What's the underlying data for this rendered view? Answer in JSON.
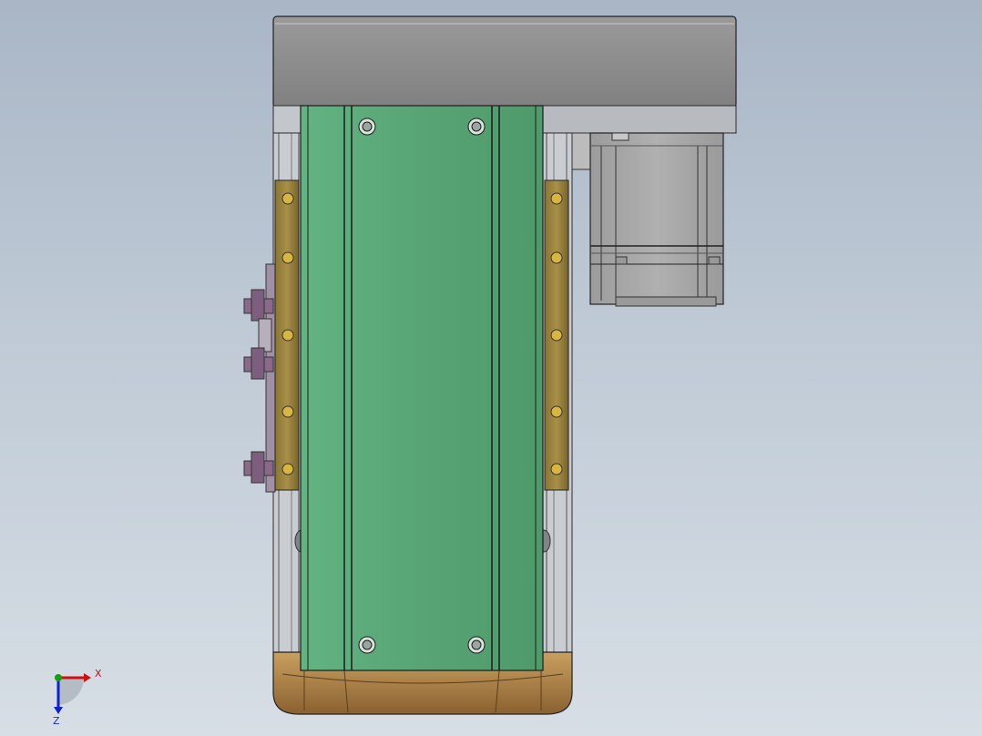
{
  "viewport": {
    "background_top": "#a9b6c6",
    "background_bottom": "#d7dee5"
  },
  "model": {
    "description_color_body": "#5aa676",
    "color_top_plate": "#8c8c8c",
    "color_rail": "#a08a3c",
    "color_motor": "#a6a6a6",
    "color_endcap": "#b58a4e",
    "color_clamp": "#8a6a8a"
  },
  "triad": {
    "x_label": "X",
    "z_label": "Z",
    "x_color": "#d01010",
    "y_color": "#10a010",
    "z_color": "#1020d0"
  }
}
